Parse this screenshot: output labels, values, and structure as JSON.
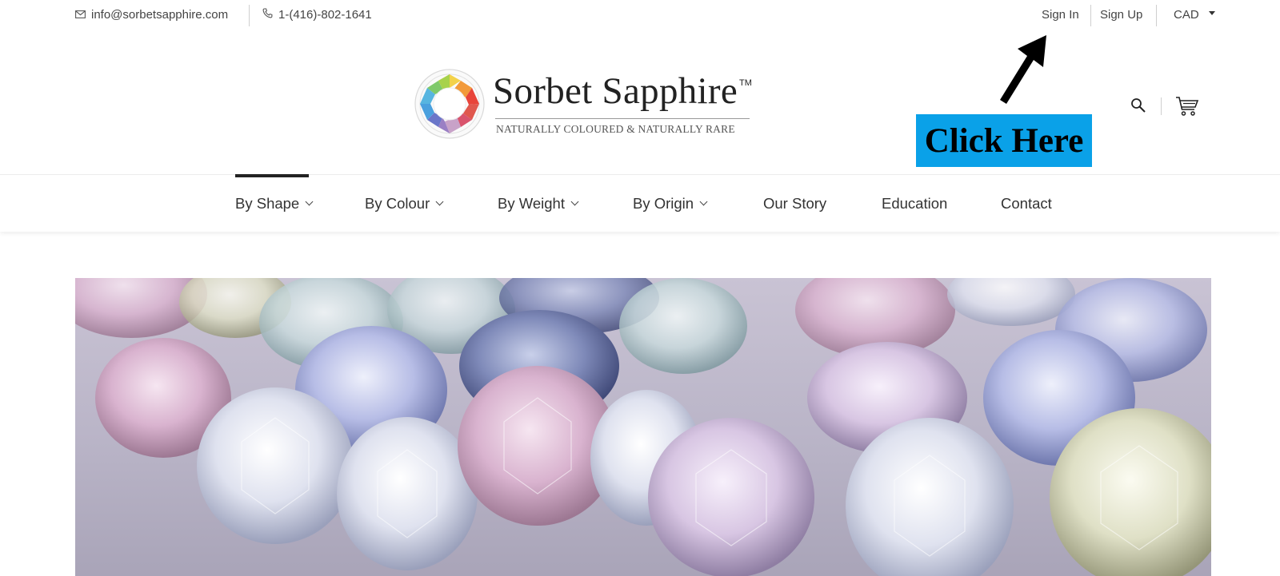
{
  "topbar": {
    "email": "info@sorbetsapphire.com",
    "phone": "1-(416)-802-1641",
    "sign_in": "Sign In",
    "sign_up": "Sign Up",
    "currency": "CAD"
  },
  "brand": {
    "name": "Sorbet Sapphire",
    "trademark": "TM",
    "tagline": "NATURALLY COLOURED & NATURALLY RARE"
  },
  "annotation": {
    "callout": "Click Here"
  },
  "icons": {
    "email": "mail-icon",
    "phone": "phone-icon",
    "search": "search-icon",
    "cart": "cart-icon",
    "dropdown": "chevron-down-icon"
  },
  "nav": {
    "items": [
      {
        "label": "By Shape",
        "dropdown": true,
        "active": true
      },
      {
        "label": "By Colour",
        "dropdown": true,
        "active": false
      },
      {
        "label": "By Weight",
        "dropdown": true,
        "active": false
      },
      {
        "label": "By Origin",
        "dropdown": true,
        "active": false
      },
      {
        "label": "Our Story",
        "dropdown": false,
        "active": false
      },
      {
        "label": "Education",
        "dropdown": false,
        "active": false
      },
      {
        "label": "Contact",
        "dropdown": false,
        "active": false
      }
    ]
  },
  "colors": {
    "callout_bg": "#0aa1e8",
    "nav_active": "#222222",
    "text": "#333333"
  }
}
